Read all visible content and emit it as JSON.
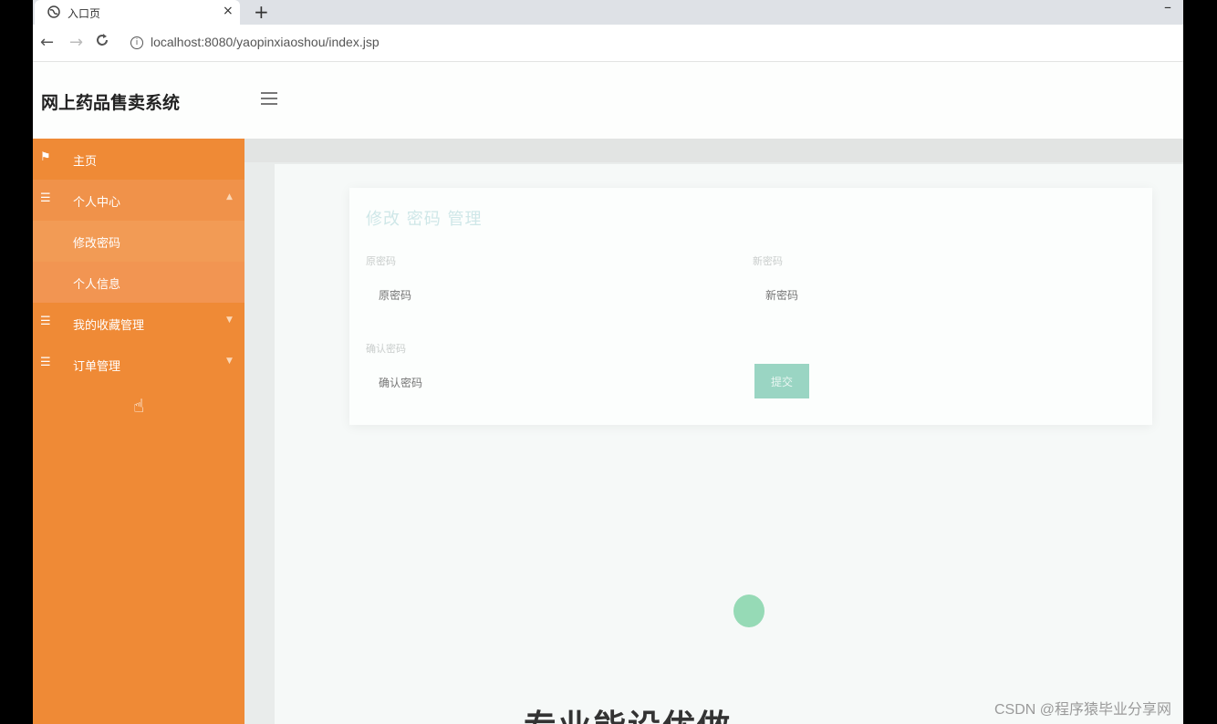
{
  "browser": {
    "tab_title": "入口页",
    "tab_close": "×",
    "new_tab": "+",
    "minimize": "–",
    "url": "localhost:8080/yaopinxiaoshou/index.jsp",
    "back_icon": "←",
    "forward_icon": "→",
    "reload_icon": "C"
  },
  "header": {
    "app_title": "网上药品售卖系统"
  },
  "sidebar": {
    "items": [
      {
        "icon": "flag-icon",
        "label": "主页"
      },
      {
        "icon": "list-icon",
        "label": "个人中心"
      },
      {
        "icon": "",
        "label": "修改密码"
      },
      {
        "icon": "",
        "label": "个人信息"
      },
      {
        "icon": "list-icon",
        "label": "我的收藏管理"
      },
      {
        "icon": "list-icon",
        "label": "订单管理"
      }
    ]
  },
  "form": {
    "title": "修改 密码 管理",
    "old_password_label": "原密码",
    "old_password_placeholder": "原密码",
    "new_password_label": "新密码",
    "new_password_placeholder": "新密码",
    "confirm_label": "确认密码",
    "confirm_placeholder": "确认密码",
    "submit_label": "提交"
  },
  "content": {
    "banner_text": "专业能设优做"
  },
  "watermark": "CSDN @程序猿毕业分享网",
  "colors": {
    "sidebar": "#ef8a36",
    "accent": "#9ad5c3"
  }
}
